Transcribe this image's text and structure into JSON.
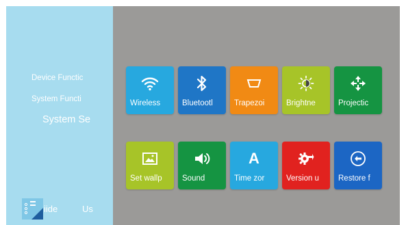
{
  "colors": {
    "sidebar_bg": "#a7dcef",
    "content_bg": "#9b9a98",
    "tile_blue": "#27a8df",
    "tile_dark_blue": "#1f76c6",
    "tile_orange": "#f18a14",
    "tile_lime": "#a7c428",
    "tile_green": "#159442",
    "tile_red": "#e1221f",
    "tile_navy": "#1c66c4"
  },
  "sidebar": {
    "items": [
      {
        "label": "Device Functic"
      },
      {
        "label": "System Functi"
      },
      {
        "label": "System Se",
        "selected": true
      }
    ],
    "bottom": {
      "guide_icon": "guide-icon",
      "guide_label": "iide",
      "user_label": "Us"
    }
  },
  "tiles": [
    {
      "label": "Wireless",
      "icon": "wifi-icon"
    },
    {
      "label": "Bluetootl",
      "icon": "bluetooth-icon"
    },
    {
      "label": "Trapezoi",
      "icon": "trapezoid-icon"
    },
    {
      "label": "Brightne",
      "icon": "brightness-icon"
    },
    {
      "label": "Projectic",
      "icon": "projection-arrows-icon"
    },
    {
      "label": "Set wallp",
      "icon": "wallpaper-icon"
    },
    {
      "label": "Sound",
      "icon": "speaker-icon"
    },
    {
      "label": "Time zor",
      "icon": "letter-a-icon",
      "icon_text": "A"
    },
    {
      "label": "Version u",
      "icon": "gear-update-icon"
    },
    {
      "label": "Restore f",
      "icon": "restore-icon"
    }
  ]
}
